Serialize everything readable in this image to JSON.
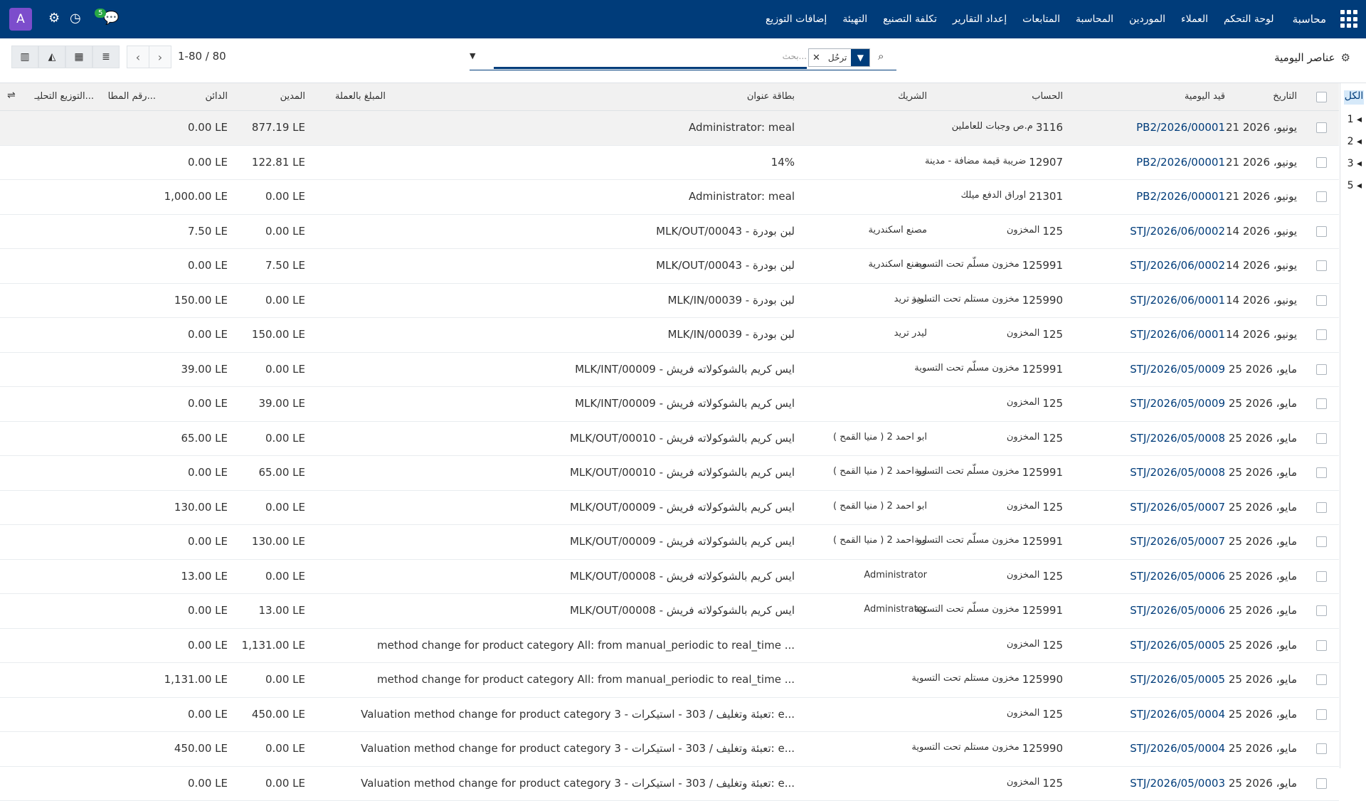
{
  "topbar": {
    "avatar_letter": "A",
    "messages_badge": "5",
    "menu": [
      "محاسبة",
      "لوحة التحكم",
      "العملاء",
      "الموردين",
      "المحاسبة",
      "المتابعات",
      "إعداد التقارير",
      "تكلفة التصنيع",
      "التهيئة",
      "إضافات التوزيع"
    ]
  },
  "control": {
    "pager": "1-80 / 80",
    "search_placeholder": "بحث...",
    "facet_label": "ترحُل",
    "title": "عناصر اليومية"
  },
  "sidepanel": {
    "all": "الكل",
    "levels": [
      "1",
      "2",
      "3",
      "5"
    ]
  },
  "headers": {
    "date": "التاريخ",
    "move": "قيد اليومية",
    "account": "الحساب",
    "partner": "الشريك",
    "label": "بطاقة عنوان",
    "amount_currency": "المبلغ بالعملة",
    "debit": "المدين",
    "credit": "الدائن",
    "matching": "رقم المطا...",
    "analytic": "التوزيع التحليـ..."
  },
  "rows": [
    {
      "date": "21 يونيو، 2026",
      "move": "PB2/2026/00001",
      "account_code": "3116",
      "account_name": "م.ص وجبات للعاملين",
      "partner": "",
      "label": "Administrator: meal",
      "debit": "877.19 LE",
      "credit": "0.00 LE"
    },
    {
      "date": "21 يونيو، 2026",
      "move": "PB2/2026/00001",
      "account_code": "12907",
      "account_name": "ضريبة قيمة مضافة - مدينة",
      "partner": "",
      "label": "14%",
      "debit": "122.81 LE",
      "credit": "0.00 LE"
    },
    {
      "date": "21 يونيو، 2026",
      "move": "PB2/2026/00001",
      "account_code": "21301",
      "account_name": "اوراق الدفع ميلك",
      "partner": "",
      "label": "Administrator: meal",
      "debit": "0.00 LE",
      "credit": "1,000.00 LE"
    },
    {
      "date": "14 يونيو، 2026",
      "move": "STJ/2026/06/0002",
      "account_code": "125",
      "account_name": "المخزون",
      "partner": "مصنع اسكندرية",
      "label": "MLK/OUT/00043 - لبن بودرة",
      "debit": "0.00 LE",
      "credit": "7.50 LE"
    },
    {
      "date": "14 يونيو، 2026",
      "move": "STJ/2026/06/0002",
      "account_code": "125991",
      "account_name": "مخزون مسلّم تحت التسوية",
      "partner": "مصنع اسكندرية",
      "label": "MLK/OUT/00043 - لبن بودرة",
      "debit": "7.50 LE",
      "credit": "0.00 LE"
    },
    {
      "date": "14 يونيو، 2026",
      "move": "STJ/2026/06/0001",
      "account_code": "125990",
      "account_name": "مخزون مستلم تحت التسوية",
      "partner": "ليدر تريد",
      "label": "MLK/IN/00039 - لبن بودرة",
      "debit": "0.00 LE",
      "credit": "150.00 LE"
    },
    {
      "date": "14 يونيو، 2026",
      "move": "STJ/2026/06/0001",
      "account_code": "125",
      "account_name": "المخزون",
      "partner": "ليدر تريد",
      "label": "MLK/IN/00039 - لبن بودرة",
      "debit": "150.00 LE",
      "credit": "0.00 LE"
    },
    {
      "date": "25 مايو، 2026",
      "move": "STJ/2026/05/0009",
      "account_code": "125991",
      "account_name": "مخزون مسلّم تحت التسوية",
      "partner": "",
      "label": "MLK/INT/00009 - ايس كريم بالشوكولاته فريش",
      "debit": "0.00 LE",
      "credit": "39.00 LE"
    },
    {
      "date": "25 مايو، 2026",
      "move": "STJ/2026/05/0009",
      "account_code": "125",
      "account_name": "المخزون",
      "partner": "",
      "label": "MLK/INT/00009 - ايس كريم بالشوكولاته فريش",
      "debit": "39.00 LE",
      "credit": "0.00 LE"
    },
    {
      "date": "25 مايو، 2026",
      "move": "STJ/2026/05/0008",
      "account_code": "125",
      "account_name": "المخزون",
      "partner": "ابو احمد 2 ( منيا القمح )",
      "label": "MLK/OUT/00010 - ايس كريم بالشوكولاته فريش",
      "debit": "0.00 LE",
      "credit": "65.00 LE"
    },
    {
      "date": "25 مايو، 2026",
      "move": "STJ/2026/05/0008",
      "account_code": "125991",
      "account_name": "مخزون مسلّم تحت التسوية",
      "partner": "ابو احمد 2 ( منيا القمح )",
      "label": "MLK/OUT/00010 - ايس كريم بالشوكولاته فريش",
      "debit": "65.00 LE",
      "credit": "0.00 LE"
    },
    {
      "date": "25 مايو، 2026",
      "move": "STJ/2026/05/0007",
      "account_code": "125",
      "account_name": "المخزون",
      "partner": "ابو احمد 2 ( منيا القمح )",
      "label": "MLK/OUT/00009 - ايس كريم بالشوكولاته فريش",
      "debit": "0.00 LE",
      "credit": "130.00 LE"
    },
    {
      "date": "25 مايو، 2026",
      "move": "STJ/2026/05/0007",
      "account_code": "125991",
      "account_name": "مخزون مسلّم تحت التسوية",
      "partner": "ابو احمد 2 ( منيا القمح )",
      "label": "MLK/OUT/00009 - ايس كريم بالشوكولاته فريش",
      "debit": "130.00 LE",
      "credit": "0.00 LE"
    },
    {
      "date": "25 مايو، 2026",
      "move": "STJ/2026/05/0006",
      "account_code": "125",
      "account_name": "المخزون",
      "partner": "Administrator",
      "label": "MLK/OUT/00008 - ايس كريم بالشوكولاته فريش",
      "debit": "0.00 LE",
      "credit": "13.00 LE"
    },
    {
      "date": "25 مايو، 2026",
      "move": "STJ/2026/05/0006",
      "account_code": "125991",
      "account_name": "مخزون مسلّم تحت التسوية",
      "partner": "Administrator",
      "label": "MLK/OUT/00008 - ايس كريم بالشوكولاته فريش",
      "debit": "13.00 LE",
      "credit": "0.00 LE"
    },
    {
      "date": "25 مايو، 2026",
      "move": "STJ/2026/05/0005",
      "account_code": "125",
      "account_name": "المخزون",
      "partner": "",
      "label": "method change for product category All: from manual_periodic to real_time ...",
      "debit": "1,131.00 LE",
      "credit": "0.00 LE"
    },
    {
      "date": "25 مايو، 2026",
      "move": "STJ/2026/05/0005",
      "account_code": "125990",
      "account_name": "مخزون مستلم تحت التسوية",
      "partner": "",
      "label": "method change for product category All: from manual_periodic to real_time ...",
      "debit": "0.00 LE",
      "credit": "1,131.00 LE"
    },
    {
      "date": "25 مايو، 2026",
      "move": "STJ/2026/05/0004",
      "account_code": "125",
      "account_name": "المخزون",
      "partner": "",
      "label": "Valuation method change for product category 3 - تعبئة وتغليف / 303 - استيكرات: e...",
      "debit": "450.00 LE",
      "credit": "0.00 LE"
    },
    {
      "date": "25 مايو، 2026",
      "move": "STJ/2026/05/0004",
      "account_code": "125990",
      "account_name": "مخزون مستلم تحت التسوية",
      "partner": "",
      "label": "Valuation method change for product category 3 - تعبئة وتغليف / 303 - استيكرات: e...",
      "debit": "0.00 LE",
      "credit": "450.00 LE"
    },
    {
      "date": "25 مايو، 2026",
      "move": "STJ/2026/05/0003",
      "account_code": "125",
      "account_name": "المخزون",
      "partner": "",
      "label": "Valuation method change for product category 3 - تعبئة وتغليف / 303 - استيكرات: e...",
      "debit": "0.00 LE",
      "credit": "0.00 LE"
    }
  ]
}
